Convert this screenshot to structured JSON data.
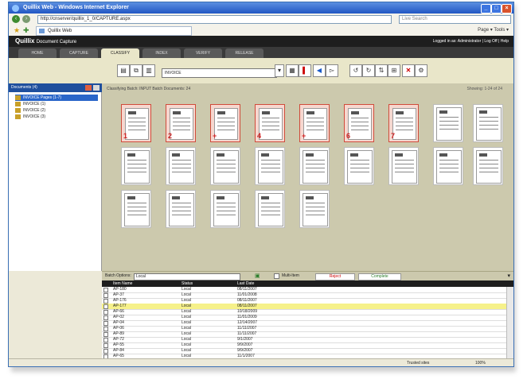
{
  "browser": {
    "title": "Quillix Web - Windows Internet Explorer",
    "url": "http://cnserver/quillix_1_0/CAPTURE.aspx",
    "search_placeholder": "Live Search",
    "favorite_tab": "Quillix Web",
    "command_bar": "Page ▾   Tools ▾",
    "status_zone": "Trusted sites",
    "zoom": "100%"
  },
  "app": {
    "logo": "Quillix",
    "logo_sub": "Document Capture",
    "user_info": "Logged in as: Administrator   |   Log Off   |   Help",
    "tabs": [
      "HOME",
      "CAPTURE",
      "CLASSIFY",
      "INDEX",
      "VERIFY",
      "RELEASE"
    ],
    "active_tab": "CLASSIFY"
  },
  "toolbar": {
    "document_type": "INVOICE"
  },
  "sidebar": {
    "header": "Documents (4)",
    "items": [
      {
        "label": "INVOICE Pages (1-7)",
        "selected": true
      },
      {
        "label": "INVOICE (1)",
        "selected": false
      },
      {
        "label": "INVOICE (2)",
        "selected": false
      },
      {
        "label": "INVOICE (3)",
        "selected": false
      }
    ]
  },
  "main": {
    "info": "Classifying Batch:   INPUT   Batch Documents:   24",
    "showing": "Showing: 1-24 of 24",
    "flag_numbers": [
      "1",
      "2",
      "+",
      "4",
      "+",
      "6",
      "7"
    ]
  },
  "bottom": {
    "label": "Batch Options:",
    "select_value": "Local",
    "checkbox_label": "Multi-Item",
    "reject_label": "Reject",
    "complete_label": "Complete"
  },
  "grid": {
    "columns": [
      "Item Name",
      "Status",
      "Last Date"
    ],
    "rows": [
      [
        "AP-180",
        "Local",
        "08/11/2007"
      ],
      [
        "AP-37",
        "Local",
        "11/01/2008"
      ],
      [
        "AP-176",
        "Local",
        "08/11/2007"
      ],
      [
        "AP-177",
        "Local",
        "08/11/2007"
      ],
      [
        "AP-66",
        "Local",
        "10/18/2009"
      ],
      [
        "AP-02",
        "Local",
        "11/01/2009"
      ],
      [
        "AP-04",
        "Local",
        "12/14/2007"
      ],
      [
        "AP-06",
        "Local",
        "11/11/2007"
      ],
      [
        "AP-89",
        "Local",
        "11/11/2007"
      ],
      [
        "AP-72",
        "Local",
        "9/1/2007"
      ],
      [
        "AP-55",
        "Local",
        "9/9/2007"
      ],
      [
        "AP-84",
        "Local",
        "9/9/2007"
      ],
      [
        "AP-65",
        "Local",
        "11/1/2007"
      ]
    ],
    "highlight_index": 3
  },
  "colors": {
    "app_header": "#1e1e1e",
    "accent_blue": "#1f4f9d",
    "highlight_row": "#f6f18a",
    "flag_red": "#d04b3a"
  }
}
